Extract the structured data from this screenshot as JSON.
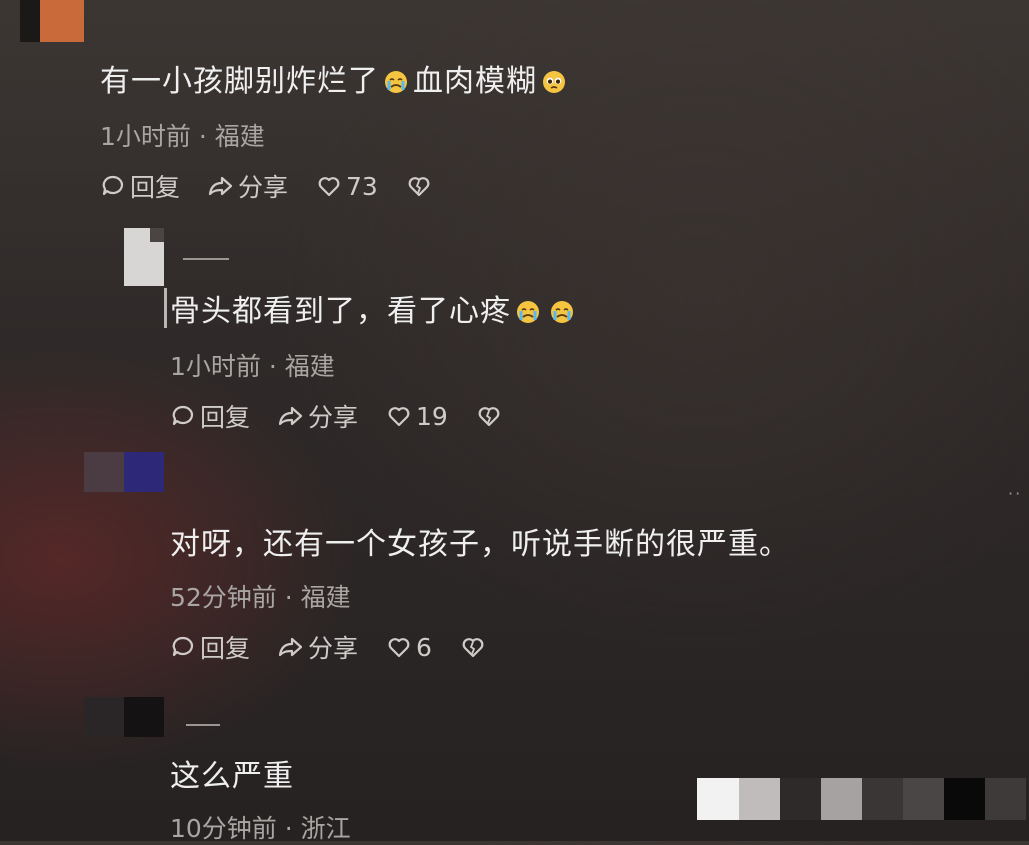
{
  "comments": [
    {
      "text": "有一小孩脚别炸烂了",
      "text_after": "血肉模糊",
      "meta": "1小时前 · 福建",
      "reply": "回复",
      "share": "分享",
      "likes": "73"
    },
    {
      "text": "骨头都看到了，看了心疼",
      "meta": "1小时前 · 福建",
      "reply": "回复",
      "share": "分享",
      "likes": "19"
    },
    {
      "text": "对呀，还有一个女孩子，听说手断的很严重。",
      "meta": "52分钟前 · 福建",
      "reply": "回复",
      "share": "分享",
      "likes": "6"
    },
    {
      "text": "这么严重",
      "meta": "10分钟前 · 浙江"
    }
  ],
  "icons": {
    "reply": "comment-bubble-icon",
    "share": "share-arrow-icon",
    "like": "heart-icon",
    "dislike": "broken-heart-icon",
    "emoji_cry": "crying-face-emoji",
    "emoji_plead": "pleading-face-emoji"
  },
  "colors": {
    "text": "#efefef",
    "meta": "#a9a5a3",
    "emoji": "#f5c542"
  }
}
